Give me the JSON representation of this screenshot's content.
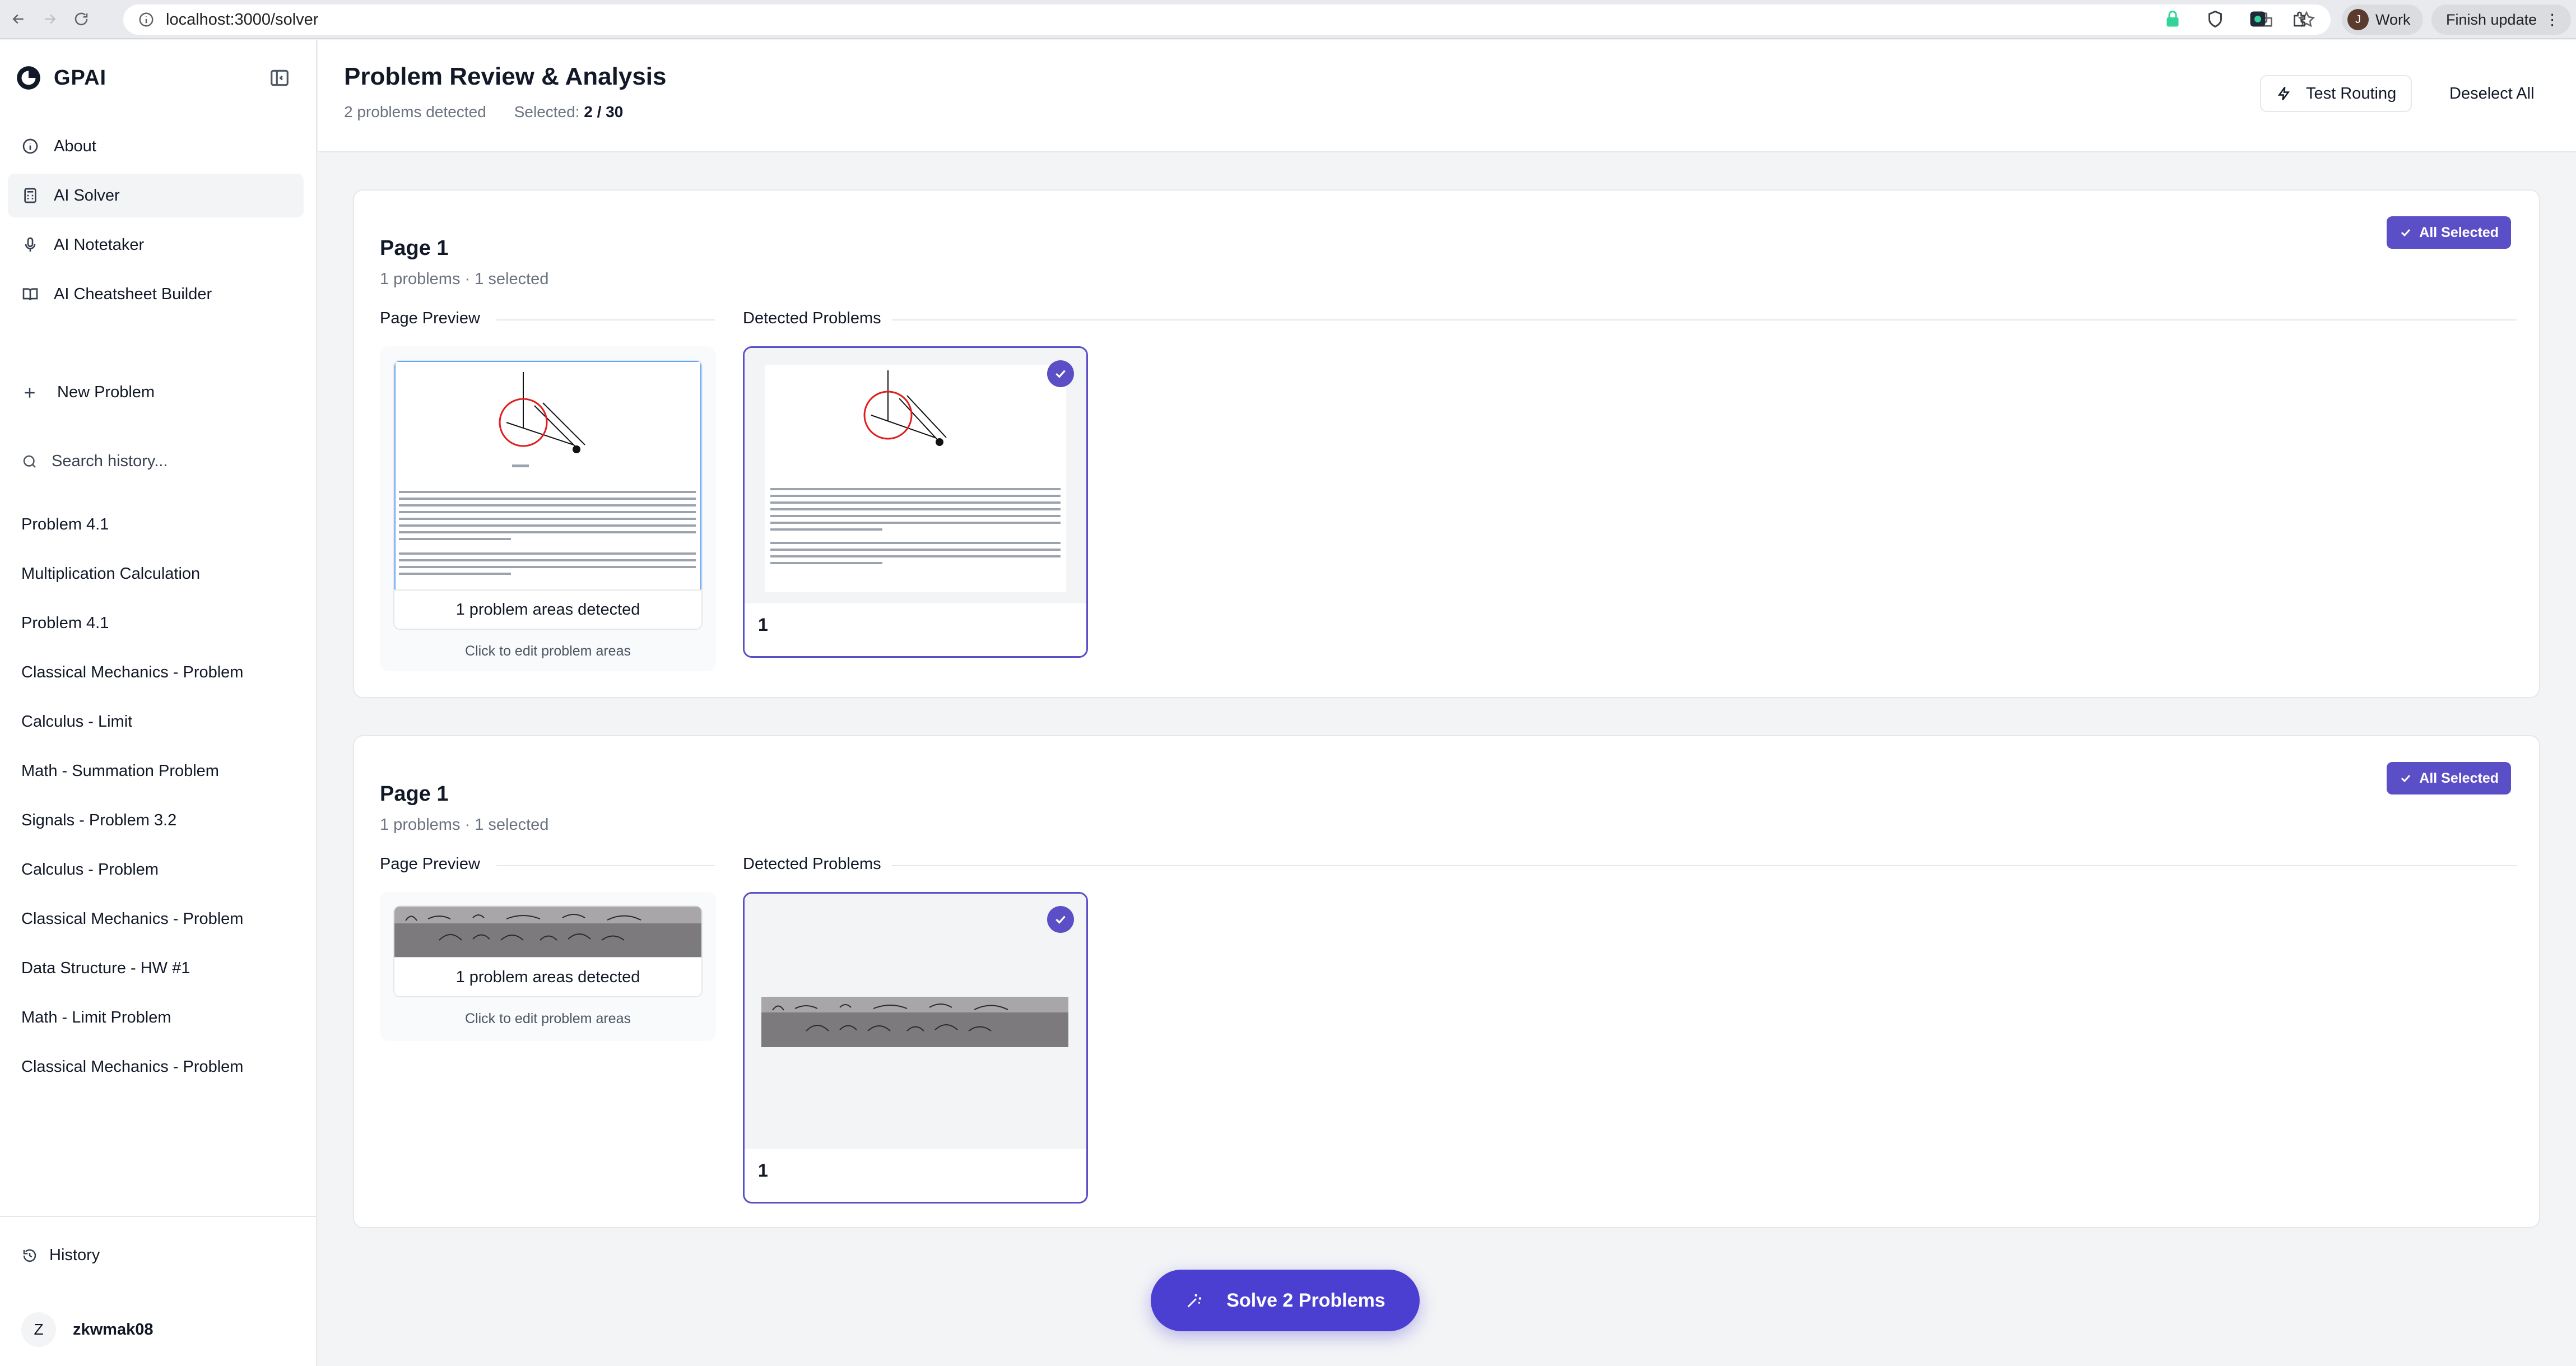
{
  "browser": {
    "url": "localhost:3000/solver",
    "profile_initial": "J",
    "profile_name": "Work",
    "finish_update": "Finish update"
  },
  "sidebar": {
    "brand": "GPAI",
    "nav": [
      {
        "label": "About",
        "icon": "info-icon"
      },
      {
        "label": "AI Solver",
        "icon": "calculator-icon"
      },
      {
        "label": "AI Notetaker",
        "icon": "microphone-icon"
      },
      {
        "label": "AI Cheatsheet Builder",
        "icon": "book-icon"
      }
    ],
    "new_problem": "New Problem",
    "search_placeholder": "Search history...",
    "history": [
      "Problem 4.1",
      "Multiplication Calculation",
      "Problem 4.1",
      "Classical Mechanics - Problem",
      "Calculus - Limit",
      "Math - Summation Problem",
      "Signals - Problem 3.2",
      "Calculus - Problem",
      "Classical Mechanics - Problem",
      "Data Structure - HW #1",
      "Math - Limit Problem",
      "Classical Mechanics - Problem"
    ],
    "history_link": "History",
    "user_initial": "Z",
    "user_name": "zkwmak08"
  },
  "header": {
    "title": "Problem Review & Analysis",
    "detected": "2 problems detected",
    "selected_label": "Selected:",
    "selected_value": "2 / 30",
    "test_routing": "Test Routing",
    "deselect_all": "Deselect All"
  },
  "pages": [
    {
      "title": "Page 1",
      "summary": "1 problems · 1 selected",
      "all_selected": "All Selected",
      "preview_label": "Page Preview",
      "detected_label": "Detected Problems",
      "areas": "1 problem areas detected",
      "edit_hint": "Click to edit problem areas",
      "problem_number": "1"
    },
    {
      "title": "Page 1",
      "summary": "1 problems · 1 selected",
      "all_selected": "All Selected",
      "preview_label": "Page Preview",
      "detected_label": "Detected Problems",
      "areas": "1 problem areas detected",
      "edit_hint": "Click to edit problem areas",
      "problem_number": "1"
    }
  ],
  "solve_button": "Solve 2 Problems",
  "colors": {
    "accent": "#5b4fc7",
    "solve": "#4b3fd1"
  }
}
